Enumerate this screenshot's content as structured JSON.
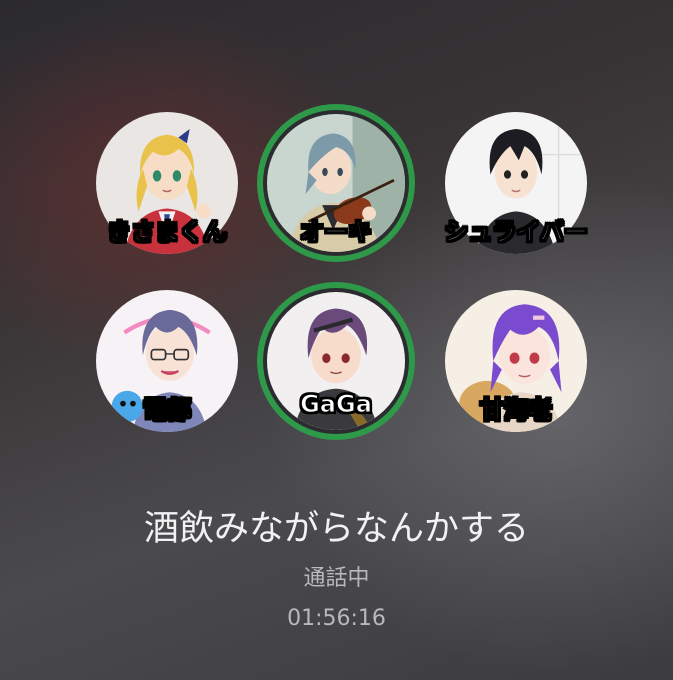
{
  "participants": [
    {
      "name": "きさまくん",
      "speaking": false,
      "avatar_icon": "anime-girl-blonde-avatar-icon"
    },
    {
      "name": "オーキ",
      "speaking": true,
      "avatar_icon": "anime-violinist-avatar-icon"
    },
    {
      "name": "シュライバー",
      "speaking": false,
      "avatar_icon": "anime-boy-black-hair-avatar-icon"
    },
    {
      "name": "電都",
      "speaking": false,
      "avatar_icon": "anime-glasses-boy-avatar-icon"
    },
    {
      "name": "GaGa",
      "speaking": true,
      "avatar_icon": "anime-purple-hair-boy-avatar-icon"
    },
    {
      "name": "甘海老",
      "speaking": false,
      "avatar_icon": "anime-purple-hair-girl-avatar-icon"
    }
  ],
  "call": {
    "title": "酒飲みながらなんかする",
    "status": "通話中",
    "timer": "01:56:16"
  },
  "colors": {
    "speaking_ring": "#2e9a49",
    "name_text": "#ffffff",
    "title_text": "#f2f2f2",
    "secondary_text": "#b9b9bc"
  }
}
